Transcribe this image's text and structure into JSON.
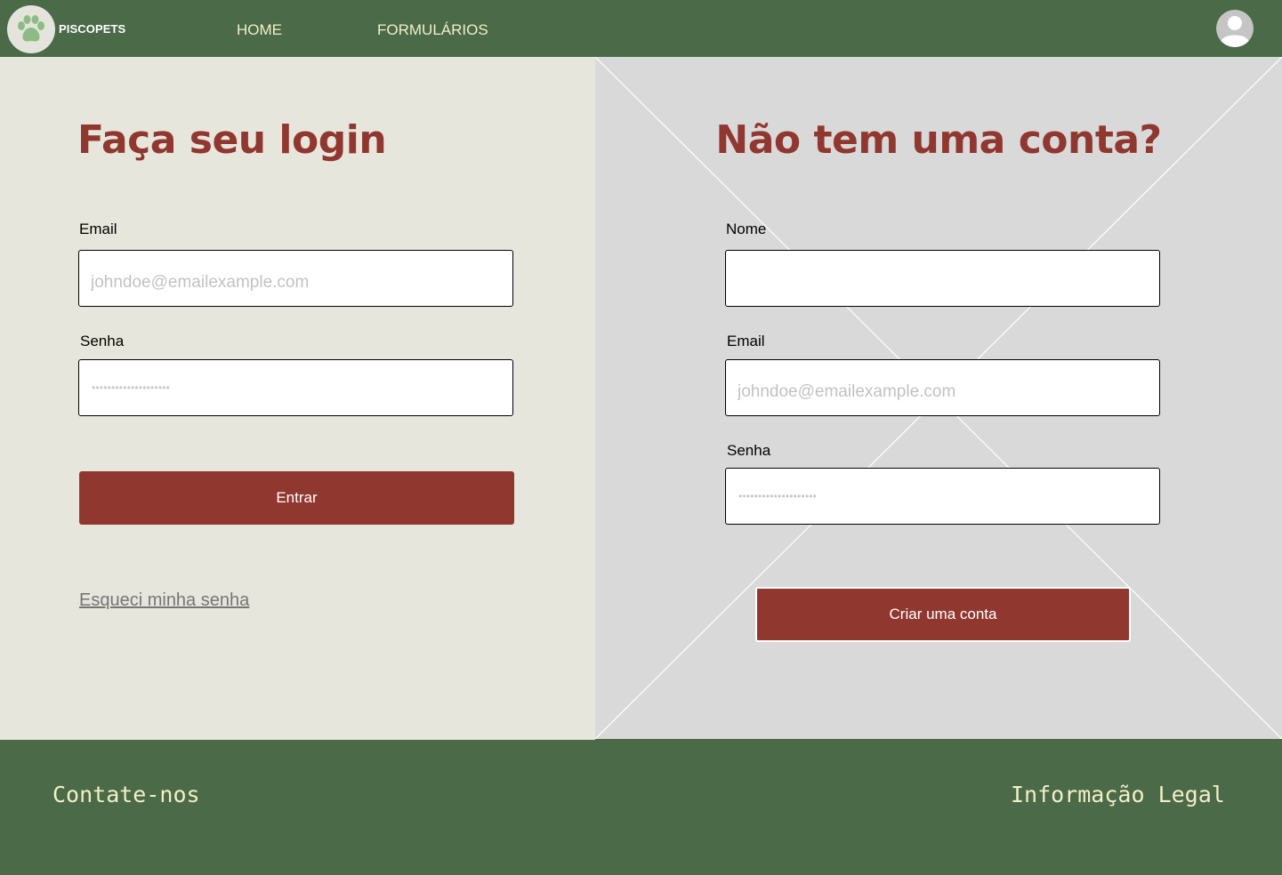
{
  "navbar": {
    "brand": "PISCOPETS",
    "links": [
      {
        "label": "HOME"
      },
      {
        "label": "FORMULÁRIOS"
      }
    ]
  },
  "login": {
    "title": "Faça seu login",
    "email_label": "Email",
    "email_placeholder": "johndoe@emailexample.com",
    "password_label": "Senha",
    "password_placeholder": "••••••••••••••••••••",
    "submit_label": "Entrar",
    "forgot_label": "Esqueci minha senha"
  },
  "signup": {
    "title": "Não tem uma conta?",
    "name_label": "Nome",
    "name_placeholder": "",
    "email_label": "Email",
    "email_placeholder": "johndoe@emailexample.com",
    "password_label": "Senha",
    "password_placeholder": "••••••••••••••••••••",
    "submit_label": "Criar uma conta"
  },
  "footer": {
    "contact_label": "Contate-nos",
    "legal_label": "Informação Legal"
  },
  "icons": {
    "logo": "paw-icon",
    "avatar": "user-avatar-icon"
  },
  "colors": {
    "primary_green": "#4a6a48",
    "accent_red": "#903830",
    "left_bg": "#e7e6dc",
    "right_bg": "#d9d9d9",
    "nav_text": "#f3eec8"
  }
}
